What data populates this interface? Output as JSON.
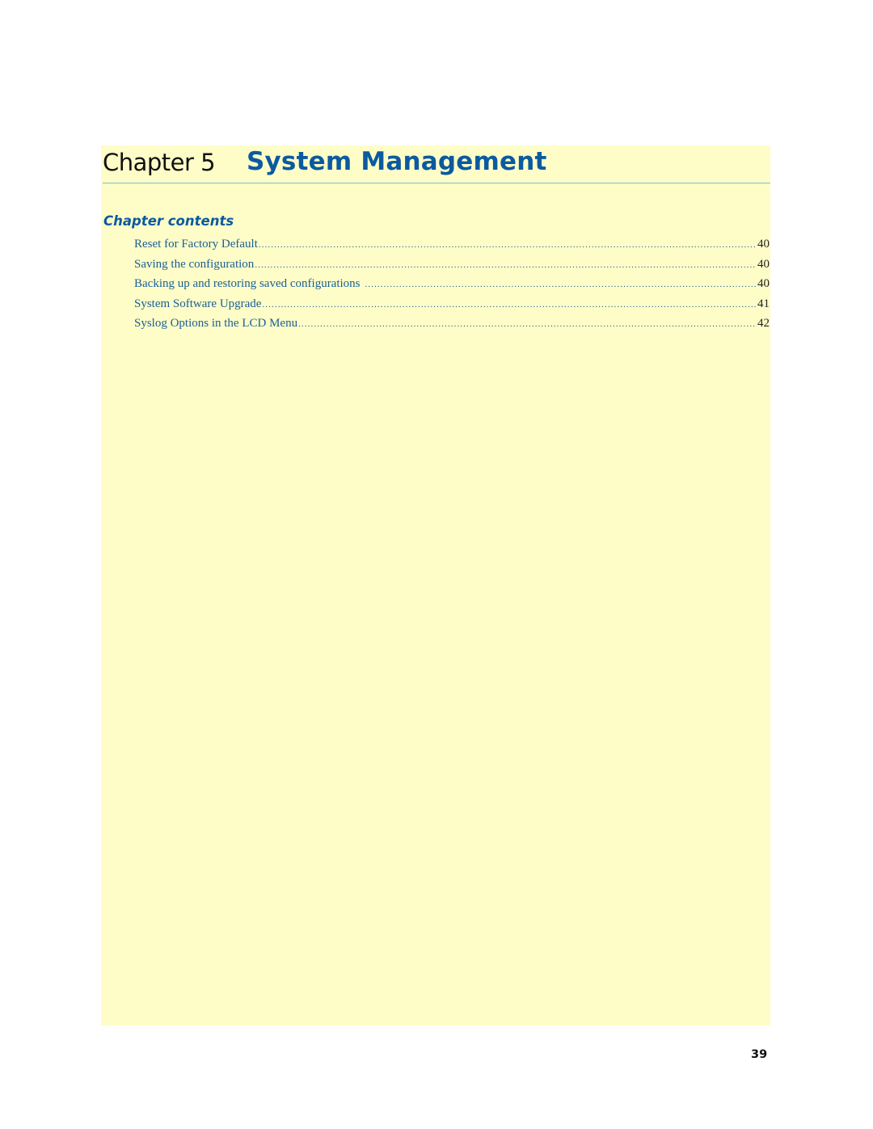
{
  "chapter": {
    "label": "Chapter 5",
    "title": "System Management"
  },
  "contents": {
    "heading": "Chapter contents",
    "entries": [
      {
        "title": "Reset for Factory Default",
        "page": "40"
      },
      {
        "title": "Saving the configuration",
        "page": "40"
      },
      {
        "title": "Backing up and restoring saved configurations",
        "page": "40"
      },
      {
        "title": "System Software Upgrade",
        "page": "41"
      },
      {
        "title": "Syslog Options in the LCD Menu",
        "page": "42"
      }
    ]
  },
  "footer": {
    "page_number": "39"
  },
  "colors": {
    "panel_background": "#fefdc8",
    "accent_blue": "#0b5aa0",
    "link_blue": "#1a5f96",
    "rule": "#7fbcc6"
  }
}
